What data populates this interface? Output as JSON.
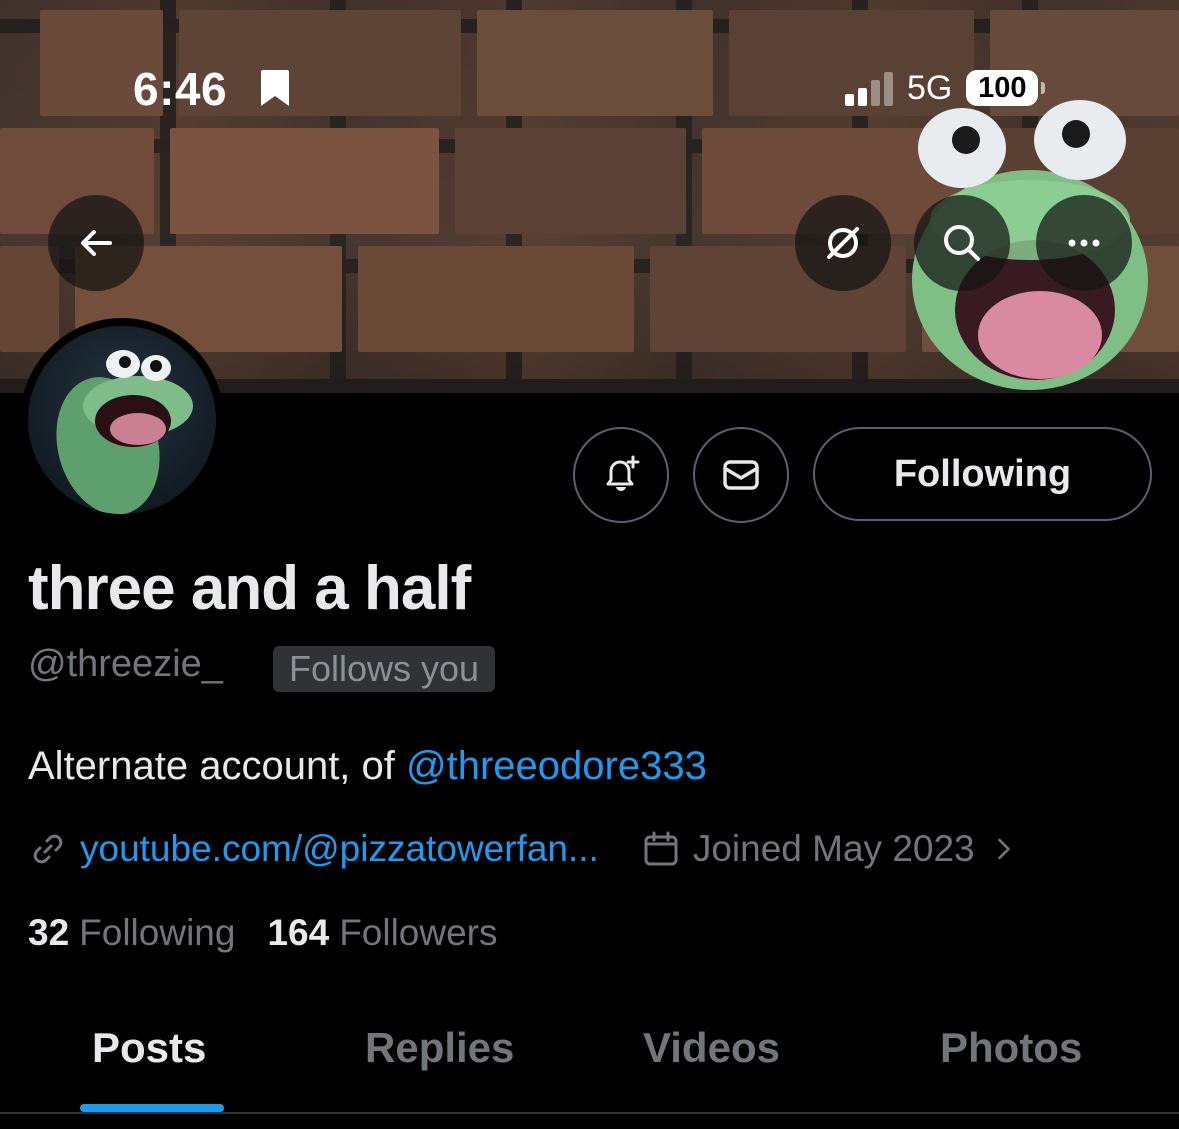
{
  "status_bar": {
    "time": "6:46",
    "network": "5G",
    "battery": "100"
  },
  "banner": {
    "back_icon": "arrow-left-icon",
    "grok_icon": "slashed-circle-icon",
    "search_icon": "search-icon",
    "more_icon": "more-horizontal-icon"
  },
  "profile": {
    "display_name": "three and a half",
    "handle": "@threezie_",
    "follows_you": "Follows you",
    "bio_text": "Alternate account, of ",
    "bio_mention": "@threeodore333",
    "website": "youtube.com/@pizzatowerfan...",
    "joined": "Joined May 2023",
    "following_count": "32",
    "following_label": "Following",
    "followers_count": "164",
    "followers_label": "Followers"
  },
  "actions": {
    "notify_icon": "bell-plus-icon",
    "message_icon": "envelope-icon",
    "following_button": "Following"
  },
  "tabs": [
    {
      "label": "Posts",
      "active": true
    },
    {
      "label": "Replies",
      "active": false
    },
    {
      "label": "Videos",
      "active": false
    },
    {
      "label": "Photos",
      "active": false
    }
  ],
  "colors": {
    "accent": "#1d9bf0",
    "background": "#000000",
    "text_primary": "#e7e9ea",
    "text_secondary": "#71767b",
    "border": "#536471"
  }
}
